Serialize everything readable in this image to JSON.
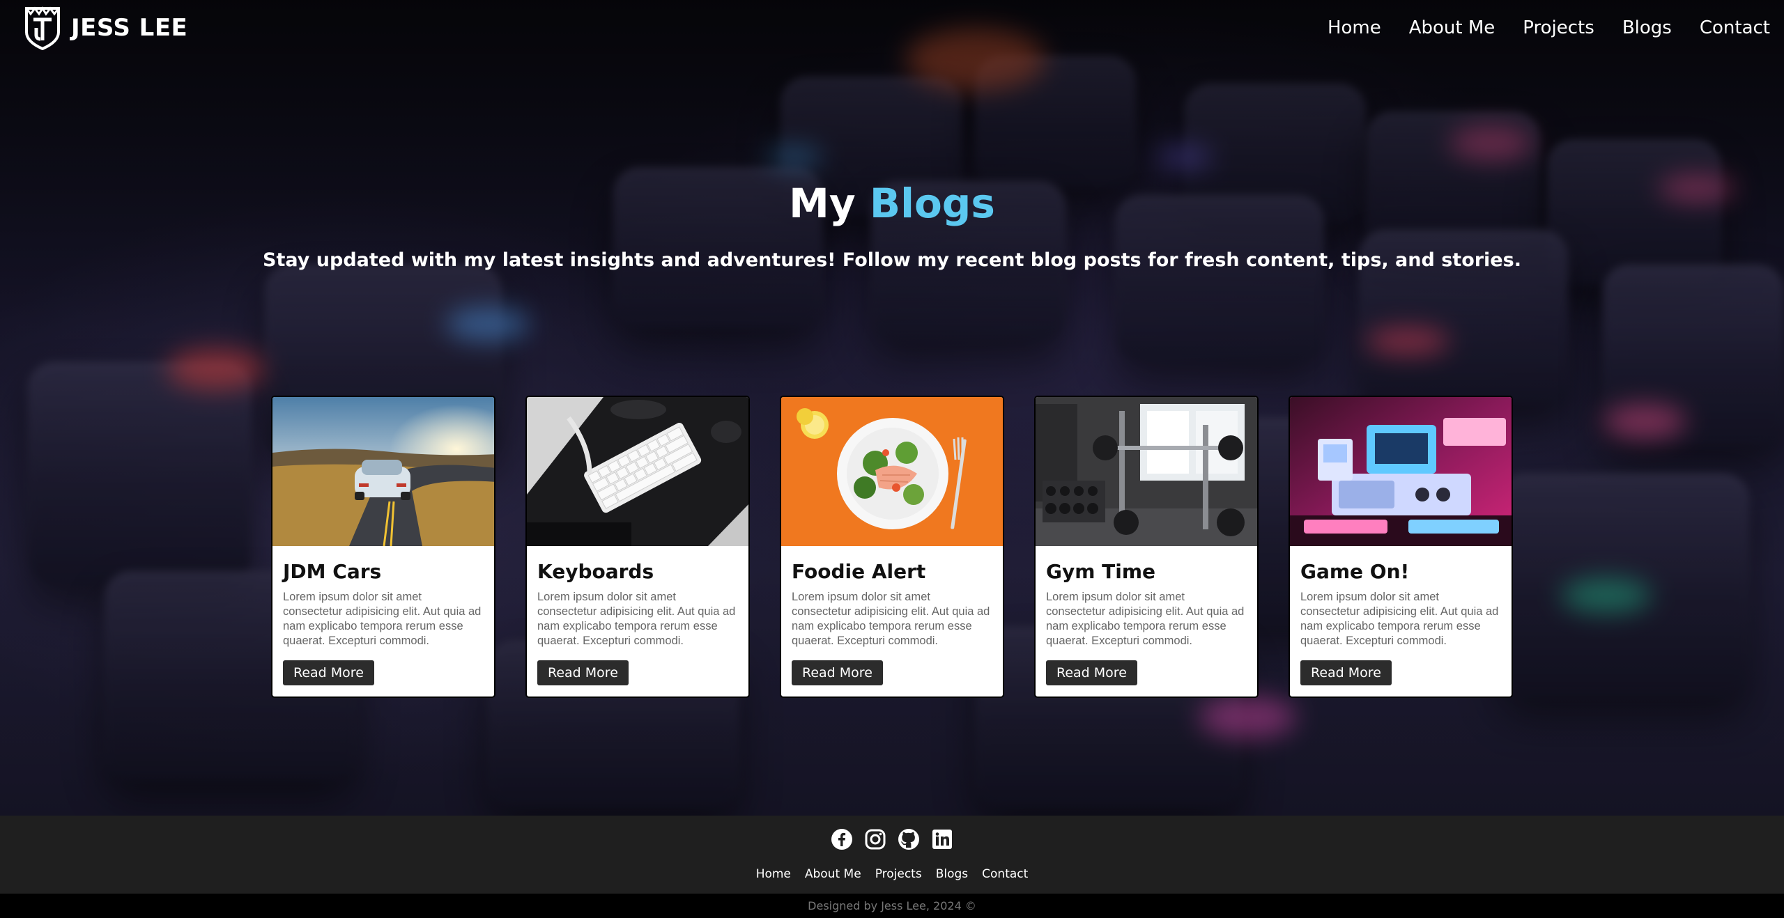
{
  "brand": {
    "name": "JESS LEE"
  },
  "nav": [
    {
      "label": "Home"
    },
    {
      "label": "About Me"
    },
    {
      "label": "Projects"
    },
    {
      "label": "Blogs"
    },
    {
      "label": "Contact"
    }
  ],
  "hero": {
    "title_prefix": "My",
    "title_accent": "Blogs",
    "subtitle": "Stay updated with my latest insights and adventures! Follow my recent blog posts for fresh content, tips, and stories."
  },
  "cards": [
    {
      "title": "JDM Cars",
      "text": "Lorem ipsum dolor sit amet consectetur adipisicing elit. Aut quia ad nam explicabo tempora rerum esse quaerat. Excepturi commodi.",
      "button": "Read More",
      "image": "car-on-road"
    },
    {
      "title": "Keyboards",
      "text": "Lorem ipsum dolor sit amet consectetur adipisicing elit. Aut quia ad nam explicabo tempora rerum esse quaerat. Excepturi commodi.",
      "button": "Read More",
      "image": "white-keyboard"
    },
    {
      "title": "Foodie Alert",
      "text": "Lorem ipsum dolor sit amet consectetur adipisicing elit. Aut quia ad nam explicabo tempora rerum esse quaerat. Excepturi commodi.",
      "button": "Read More",
      "image": "salad-plate"
    },
    {
      "title": "Gym Time",
      "text": "Lorem ipsum dolor sit amet consectetur adipisicing elit. Aut quia ad nam explicabo tempora rerum esse quaerat. Excepturi commodi.",
      "button": "Read More",
      "image": "gym-equipment"
    },
    {
      "title": "Game On!",
      "text": "Lorem ipsum dolor sit amet consectetur adipisicing elit. Aut quia ad nam explicabo tempora rerum esse quaerat. Excepturi commodi.",
      "button": "Read More",
      "image": "retro-consoles"
    }
  ],
  "footer": {
    "social": [
      "facebook-icon",
      "instagram-icon",
      "github-icon",
      "linkedin-icon"
    ],
    "nav": [
      {
        "label": "Home"
      },
      {
        "label": "About Me"
      },
      {
        "label": "Projects"
      },
      {
        "label": "Blogs"
      },
      {
        "label": "Contact"
      }
    ],
    "copyright": "Designed by Jess Lee, 2024 ©"
  },
  "colors": {
    "accent": "#5bc8f0",
    "button_bg": "#2c2c2c",
    "footer_bg": "#1f1f1f",
    "copyright_bg": "#000000"
  }
}
